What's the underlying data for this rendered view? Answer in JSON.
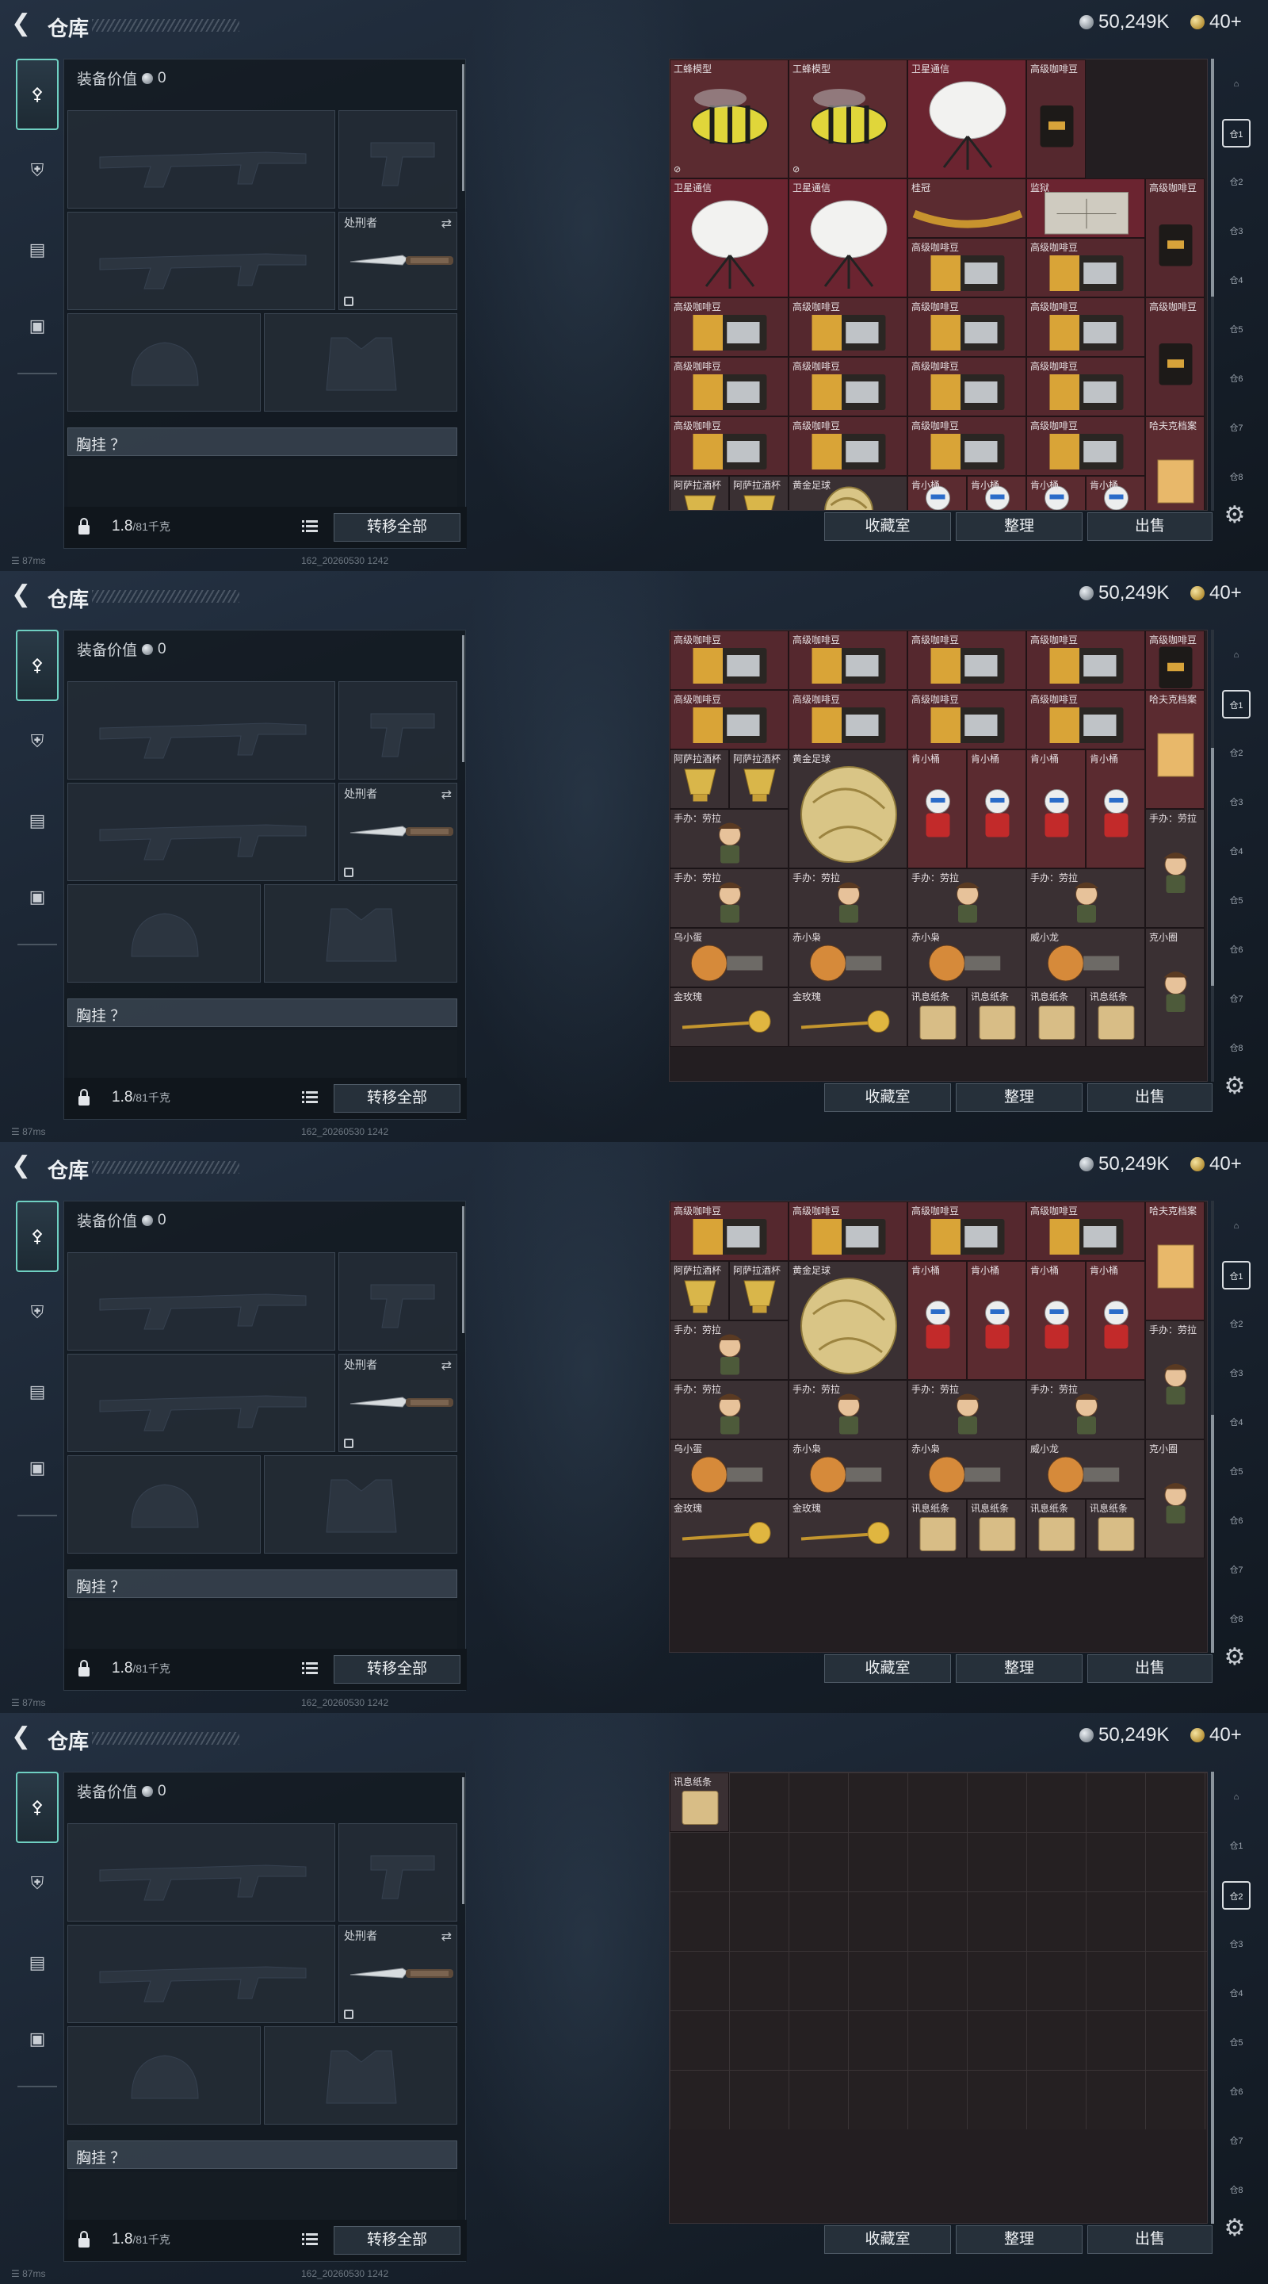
{
  "header": {
    "title": "仓库",
    "currency": "50,249K",
    "level": "40+"
  },
  "side_tabs": [
    {
      "name": "weapon-tab",
      "icon": "gun-icon",
      "active": true
    },
    {
      "name": "armor-tab",
      "icon": "shield-icon",
      "active": false
    },
    {
      "name": "backpack-tab",
      "icon": "clipboard-icon",
      "active": false
    },
    {
      "name": "case-tab",
      "icon": "briefcase-icon",
      "active": false
    }
  ],
  "equipment": {
    "value_label": "装备价值",
    "value": "0",
    "melee_slot_label": "处刑者",
    "chest_label": "胸挂 ？",
    "weight_value": "1.8",
    "weight_max": "/81千克",
    "transfer_all": "转移全部"
  },
  "stash_buttons": {
    "collection": "收藏室",
    "sort": "整理",
    "sell": "出售"
  },
  "status": {
    "ping": "87ms",
    "build": "162_20260530 1242"
  },
  "right_bar": [
    "home-icon",
    "stash-1-icon",
    "stash-2-icon",
    "stash-3-icon",
    "stash-4-icon",
    "stash-5-icon",
    "stash-6-icon",
    "stash-7-icon",
    "stash-8-icon"
  ],
  "screens": [
    {
      "active_stash": 1,
      "scroll": 0.0,
      "items": [
        {
          "label": "工蜂模型",
          "c": 0,
          "r": 0,
          "w": 2,
          "h": 2,
          "bg": "#5b2b30",
          "kind": "bee",
          "bound": true
        },
        {
          "label": "工蜂模型",
          "c": 2,
          "r": 0,
          "w": 2,
          "h": 2,
          "bg": "#5b2b30",
          "kind": "bee",
          "bound": true
        },
        {
          "label": "卫星通信",
          "c": 4,
          "r": 0,
          "w": 2,
          "h": 2,
          "bg": "#6b2430",
          "kind": "dish"
        },
        {
          "label": "高级咖啡豆",
          "c": 6,
          "r": 0,
          "w": 1,
          "h": 2,
          "bg": "#55282e",
          "kind": "bag"
        },
        {
          "label": "卫星通信",
          "c": 0,
          "r": 2,
          "w": 2,
          "h": 2,
          "bg": "#6b2430",
          "kind": "dish"
        },
        {
          "label": "卫星通信",
          "c": 2,
          "r": 2,
          "w": 2,
          "h": 2,
          "bg": "#6b2430",
          "kind": "dish"
        },
        {
          "label": "桂冠",
          "c": 4,
          "r": 2,
          "w": 2,
          "h": 1,
          "bg": "#5b2b30",
          "kind": "crown"
        },
        {
          "label": "监狱",
          "c": 6,
          "r": 2,
          "w": 2,
          "h": 1,
          "bg": "#6b2430",
          "kind": "map"
        },
        {
          "label": "高级咖啡豆",
          "c": 8,
          "r": 2,
          "w": 1,
          "h": 2,
          "bg": "#55282e",
          "kind": "bag"
        },
        {
          "label": "高级咖啡豆",
          "c": 4,
          "r": 3,
          "w": 2,
          "h": 1,
          "bg": "#55282e",
          "kind": "box"
        },
        {
          "label": "高级咖啡豆",
          "c": 6,
          "r": 3,
          "w": 2,
          "h": 1,
          "bg": "#55282e",
          "kind": "box"
        },
        {
          "label": "高级咖啡豆",
          "c": 0,
          "r": 4,
          "w": 2,
          "h": 1,
          "bg": "#55282e",
          "kind": "box"
        },
        {
          "label": "高级咖啡豆",
          "c": 2,
          "r": 4,
          "w": 2,
          "h": 1,
          "bg": "#55282e",
          "kind": "box"
        },
        {
          "label": "高级咖啡豆",
          "c": 4,
          "r": 4,
          "w": 2,
          "h": 1,
          "bg": "#55282e",
          "kind": "box"
        },
        {
          "label": "高级咖啡豆",
          "c": 6,
          "r": 4,
          "w": 2,
          "h": 1,
          "bg": "#55282e",
          "kind": "box"
        },
        {
          "label": "高级咖啡豆",
          "c": 8,
          "r": 4,
          "w": 1,
          "h": 2,
          "bg": "#55282e",
          "kind": "bag"
        },
        {
          "label": "高级咖啡豆",
          "c": 0,
          "r": 5,
          "w": 2,
          "h": 1,
          "bg": "#55282e",
          "kind": "box"
        },
        {
          "label": "高级咖啡豆",
          "c": 2,
          "r": 5,
          "w": 2,
          "h": 1,
          "bg": "#55282e",
          "kind": "box"
        },
        {
          "label": "高级咖啡豆",
          "c": 4,
          "r": 5,
          "w": 2,
          "h": 1,
          "bg": "#55282e",
          "kind": "box"
        },
        {
          "label": "高级咖啡豆",
          "c": 6,
          "r": 5,
          "w": 2,
          "h": 1,
          "bg": "#55282e",
          "kind": "box"
        },
        {
          "label": "高级咖啡豆",
          "c": 0,
          "r": 6,
          "w": 2,
          "h": 1,
          "bg": "#55282e",
          "kind": "box"
        },
        {
          "label": "高级咖啡豆",
          "c": 2,
          "r": 6,
          "w": 2,
          "h": 1,
          "bg": "#55282e",
          "kind": "box"
        },
        {
          "label": "高级咖啡豆",
          "c": 4,
          "r": 6,
          "w": 2,
          "h": 1,
          "bg": "#55282e",
          "kind": "box"
        },
        {
          "label": "高级咖啡豆",
          "c": 6,
          "r": 6,
          "w": 2,
          "h": 1,
          "bg": "#55282e",
          "kind": "box"
        },
        {
          "label": "哈夫克档案",
          "c": 8,
          "r": 6,
          "w": 1,
          "h": 2,
          "bg": "#5b2b30",
          "kind": "doc"
        },
        {
          "label": "阿萨拉酒杯",
          "c": 0,
          "r": 7,
          "w": 1,
          "h": 1,
          "bg": "#3a3033",
          "kind": "cup"
        },
        {
          "label": "阿萨拉酒杯",
          "c": 1,
          "r": 7,
          "w": 1,
          "h": 1,
          "bg": "#3a3033",
          "kind": "cup"
        },
        {
          "label": "黄金足球",
          "c": 2,
          "r": 7,
          "w": 2,
          "h": 1,
          "bg": "#3a3033",
          "kind": "ball"
        },
        {
          "label": "肯小桶",
          "c": 4,
          "r": 7,
          "w": 1,
          "h": 1,
          "bg": "#5b2b30",
          "kind": "fig"
        },
        {
          "label": "肯小桶",
          "c": 5,
          "r": 7,
          "w": 1,
          "h": 1,
          "bg": "#5b2b30",
          "kind": "fig"
        },
        {
          "label": "肯小桶",
          "c": 6,
          "r": 7,
          "w": 1,
          "h": 1,
          "bg": "#5b2b30",
          "kind": "fig"
        },
        {
          "label": "肯小桶",
          "c": 7,
          "r": 7,
          "w": 1,
          "h": 1,
          "bg": "#5b2b30",
          "kind": "fig"
        }
      ]
    },
    {
      "active_stash": 1,
      "scroll": 0.55,
      "items": [
        {
          "label": "高级咖啡豆",
          "c": 0,
          "r": 0,
          "w": 2,
          "h": 1,
          "bg": "#55282e",
          "kind": "box"
        },
        {
          "label": "高级咖啡豆",
          "c": 2,
          "r": 0,
          "w": 2,
          "h": 1,
          "bg": "#55282e",
          "kind": "box"
        },
        {
          "label": "高级咖啡豆",
          "c": 4,
          "r": 0,
          "w": 2,
          "h": 1,
          "bg": "#55282e",
          "kind": "box"
        },
        {
          "label": "高级咖啡豆",
          "c": 6,
          "r": 0,
          "w": 2,
          "h": 1,
          "bg": "#55282e",
          "kind": "box"
        },
        {
          "label": "高级咖啡豆",
          "c": 8,
          "r": 0,
          "w": 1,
          "h": 1,
          "bg": "#55282e",
          "kind": "bag"
        },
        {
          "label": "高级咖啡豆",
          "c": 0,
          "r": 1,
          "w": 2,
          "h": 1,
          "bg": "#55282e",
          "kind": "box"
        },
        {
          "label": "高级咖啡豆",
          "c": 2,
          "r": 1,
          "w": 2,
          "h": 1,
          "bg": "#55282e",
          "kind": "box"
        },
        {
          "label": "高级咖啡豆",
          "c": 4,
          "r": 1,
          "w": 2,
          "h": 1,
          "bg": "#55282e",
          "kind": "box"
        },
        {
          "label": "高级咖啡豆",
          "c": 6,
          "r": 1,
          "w": 2,
          "h": 1,
          "bg": "#55282e",
          "kind": "box"
        },
        {
          "label": "哈夫克档案",
          "c": 8,
          "r": 1,
          "w": 1,
          "h": 2,
          "bg": "#5b2b30",
          "kind": "doc"
        },
        {
          "label": "阿萨拉酒杯",
          "c": 0,
          "r": 2,
          "w": 1,
          "h": 1,
          "bg": "#3a3033",
          "kind": "cup"
        },
        {
          "label": "阿萨拉酒杯",
          "c": 1,
          "r": 2,
          "w": 1,
          "h": 1,
          "bg": "#3a3033",
          "kind": "cup"
        },
        {
          "label": "黄金足球",
          "c": 2,
          "r": 2,
          "w": 2,
          "h": 2,
          "bg": "#3a3033",
          "kind": "ball"
        },
        {
          "label": "肯小桶",
          "c": 4,
          "r": 2,
          "w": 1,
          "h": 2,
          "bg": "#5b2b30",
          "kind": "fig"
        },
        {
          "label": "肯小桶",
          "c": 5,
          "r": 2,
          "w": 1,
          "h": 2,
          "bg": "#5b2b30",
          "kind": "fig"
        },
        {
          "label": "肯小桶",
          "c": 6,
          "r": 2,
          "w": 1,
          "h": 2,
          "bg": "#5b2b30",
          "kind": "fig"
        },
        {
          "label": "肯小桶",
          "c": 7,
          "r": 2,
          "w": 1,
          "h": 2,
          "bg": "#5b2b30",
          "kind": "fig"
        },
        {
          "label": "手办：劳拉",
          "c": 0,
          "r": 3,
          "w": 2,
          "h": 1,
          "bg": "#3a3033",
          "kind": "doll"
        },
        {
          "label": "手办：劳拉",
          "c": 8,
          "r": 3,
          "w": 1,
          "h": 2,
          "bg": "#3a3033",
          "kind": "doll"
        },
        {
          "label": "手办：劳拉",
          "c": 0,
          "r": 4,
          "w": 2,
          "h": 1,
          "bg": "#3a3033",
          "kind": "doll"
        },
        {
          "label": "手办：劳拉",
          "c": 2,
          "r": 4,
          "w": 2,
          "h": 1,
          "bg": "#3a3033",
          "kind": "doll"
        },
        {
          "label": "手办：劳拉",
          "c": 4,
          "r": 4,
          "w": 2,
          "h": 1,
          "bg": "#3a3033",
          "kind": "doll"
        },
        {
          "label": "手办：劳拉",
          "c": 6,
          "r": 4,
          "w": 2,
          "h": 1,
          "bg": "#3a3033",
          "kind": "doll"
        },
        {
          "label": "乌小蛋",
          "c": 0,
          "r": 5,
          "w": 2,
          "h": 1,
          "bg": "#3a3033",
          "kind": "toy"
        },
        {
          "label": "赤小枭",
          "c": 2,
          "r": 5,
          "w": 2,
          "h": 1,
          "bg": "#3a3033",
          "kind": "toy"
        },
        {
          "label": "赤小枭",
          "c": 4,
          "r": 5,
          "w": 2,
          "h": 1,
          "bg": "#3a3033",
          "kind": "toy"
        },
        {
          "label": "威小龙",
          "c": 6,
          "r": 5,
          "w": 2,
          "h": 1,
          "bg": "#3a3033",
          "kind": "toy"
        },
        {
          "label": "克小圈",
          "c": 8,
          "r": 5,
          "w": 1,
          "h": 2,
          "bg": "#3a3033",
          "kind": "doll"
        },
        {
          "label": "金玫瑰",
          "c": 0,
          "r": 6,
          "w": 2,
          "h": 1,
          "bg": "#3a3033",
          "kind": "rose"
        },
        {
          "label": "金玫瑰",
          "c": 2,
          "r": 6,
          "w": 2,
          "h": 1,
          "bg": "#3a3033",
          "kind": "rose"
        },
        {
          "label": "讯息纸条",
          "c": 4,
          "r": 6,
          "w": 1,
          "h": 1,
          "bg": "#3a3033",
          "kind": "note"
        },
        {
          "label": "讯息纸条",
          "c": 5,
          "r": 6,
          "w": 1,
          "h": 1,
          "bg": "#3a3033",
          "kind": "note"
        },
        {
          "label": "讯息纸条",
          "c": 6,
          "r": 6,
          "w": 1,
          "h": 1,
          "bg": "#3a3033",
          "kind": "note"
        },
        {
          "label": "讯息纸条",
          "c": 7,
          "r": 6,
          "w": 1,
          "h": 1,
          "bg": "#3a3033",
          "kind": "note"
        }
      ]
    },
    {
      "active_stash": 1,
      "scroll": 1.0,
      "items": [
        {
          "label": "高级咖啡豆",
          "c": 0,
          "r": 0,
          "w": 2,
          "h": 1,
          "bg": "#55282e",
          "kind": "box"
        },
        {
          "label": "高级咖啡豆",
          "c": 2,
          "r": 0,
          "w": 2,
          "h": 1,
          "bg": "#55282e",
          "kind": "box"
        },
        {
          "label": "高级咖啡豆",
          "c": 4,
          "r": 0,
          "w": 2,
          "h": 1,
          "bg": "#55282e",
          "kind": "box"
        },
        {
          "label": "高级咖啡豆",
          "c": 6,
          "r": 0,
          "w": 2,
          "h": 1,
          "bg": "#55282e",
          "kind": "box"
        },
        {
          "label": "哈夫克档案",
          "c": 8,
          "r": 0,
          "w": 1,
          "h": 2,
          "bg": "#5b2b30",
          "kind": "doc"
        },
        {
          "label": "阿萨拉酒杯",
          "c": 0,
          "r": 1,
          "w": 1,
          "h": 1,
          "bg": "#3a3033",
          "kind": "cup"
        },
        {
          "label": "阿萨拉酒杯",
          "c": 1,
          "r": 1,
          "w": 1,
          "h": 1,
          "bg": "#3a3033",
          "kind": "cup"
        },
        {
          "label": "黄金足球",
          "c": 2,
          "r": 1,
          "w": 2,
          "h": 2,
          "bg": "#3a3033",
          "kind": "ball"
        },
        {
          "label": "肯小桶",
          "c": 4,
          "r": 1,
          "w": 1,
          "h": 2,
          "bg": "#5b2b30",
          "kind": "fig"
        },
        {
          "label": "肯小桶",
          "c": 5,
          "r": 1,
          "w": 1,
          "h": 2,
          "bg": "#5b2b30",
          "kind": "fig"
        },
        {
          "label": "肯小桶",
          "c": 6,
          "r": 1,
          "w": 1,
          "h": 2,
          "bg": "#5b2b30",
          "kind": "fig"
        },
        {
          "label": "肯小桶",
          "c": 7,
          "r": 1,
          "w": 1,
          "h": 2,
          "bg": "#5b2b30",
          "kind": "fig"
        },
        {
          "label": "手办：劳拉",
          "c": 0,
          "r": 2,
          "w": 2,
          "h": 1,
          "bg": "#3a3033",
          "kind": "doll"
        },
        {
          "label": "手办：劳拉",
          "c": 8,
          "r": 2,
          "w": 1,
          "h": 2,
          "bg": "#3a3033",
          "kind": "doll"
        },
        {
          "label": "手办：劳拉",
          "c": 0,
          "r": 3,
          "w": 2,
          "h": 1,
          "bg": "#3a3033",
          "kind": "doll"
        },
        {
          "label": "手办：劳拉",
          "c": 2,
          "r": 3,
          "w": 2,
          "h": 1,
          "bg": "#3a3033",
          "kind": "doll"
        },
        {
          "label": "手办：劳拉",
          "c": 4,
          "r": 3,
          "w": 2,
          "h": 1,
          "bg": "#3a3033",
          "kind": "doll"
        },
        {
          "label": "手办：劳拉",
          "c": 6,
          "r": 3,
          "w": 2,
          "h": 1,
          "bg": "#3a3033",
          "kind": "doll"
        },
        {
          "label": "乌小蛋",
          "c": 0,
          "r": 4,
          "w": 2,
          "h": 1,
          "bg": "#3a3033",
          "kind": "toy"
        },
        {
          "label": "赤小枭",
          "c": 2,
          "r": 4,
          "w": 2,
          "h": 1,
          "bg": "#3a3033",
          "kind": "toy"
        },
        {
          "label": "赤小枭",
          "c": 4,
          "r": 4,
          "w": 2,
          "h": 1,
          "bg": "#3a3033",
          "kind": "toy"
        },
        {
          "label": "威小龙",
          "c": 6,
          "r": 4,
          "w": 2,
          "h": 1,
          "bg": "#3a3033",
          "kind": "toy"
        },
        {
          "label": "克小圈",
          "c": 8,
          "r": 4,
          "w": 1,
          "h": 2,
          "bg": "#3a3033",
          "kind": "doll"
        },
        {
          "label": "金玫瑰",
          "c": 0,
          "r": 5,
          "w": 2,
          "h": 1,
          "bg": "#3a3033",
          "kind": "rose"
        },
        {
          "label": "金玫瑰",
          "c": 2,
          "r": 5,
          "w": 2,
          "h": 1,
          "bg": "#3a3033",
          "kind": "rose"
        },
        {
          "label": "讯息纸条",
          "c": 4,
          "r": 5,
          "w": 1,
          "h": 1,
          "bg": "#3a3033",
          "kind": "note"
        },
        {
          "label": "讯息纸条",
          "c": 5,
          "r": 5,
          "w": 1,
          "h": 1,
          "bg": "#3a3033",
          "kind": "note"
        },
        {
          "label": "讯息纸条",
          "c": 6,
          "r": 5,
          "w": 1,
          "h": 1,
          "bg": "#3a3033",
          "kind": "note"
        },
        {
          "label": "讯息纸条",
          "c": 7,
          "r": 5,
          "w": 1,
          "h": 1,
          "bg": "#3a3033",
          "kind": "note"
        }
      ]
    },
    {
      "active_stash": 2,
      "scroll": null,
      "items": [
        {
          "label": "讯息纸条",
          "c": 0,
          "r": 0,
          "w": 1,
          "h": 1,
          "bg": "#3a3033",
          "kind": "note"
        }
      ]
    }
  ]
}
